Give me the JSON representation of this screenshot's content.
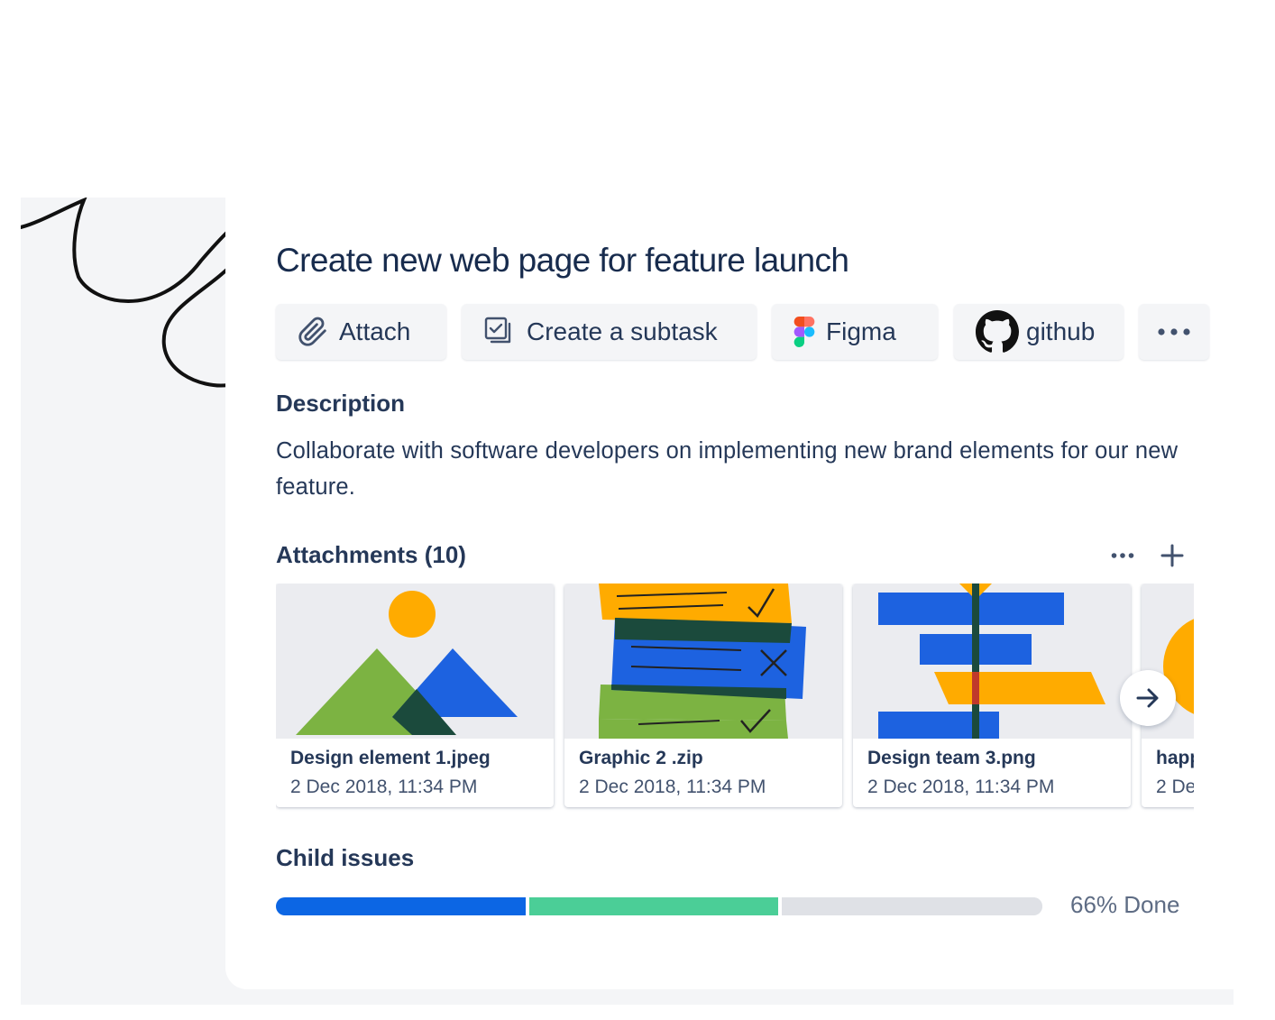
{
  "issue": {
    "title": "Create new web page for feature launch"
  },
  "toolbar": {
    "attach_label": "Attach",
    "subtask_label": "Create a subtask",
    "figma_label": "Figma",
    "github_label": "github",
    "icons": [
      "paperclip-icon",
      "subtask-icon",
      "figma-logo-icon",
      "github-logo-icon",
      "more-icon"
    ]
  },
  "description": {
    "heading": "Description",
    "text": "Collaborate with software developers on implementing new brand elements for our new feature."
  },
  "attachments": {
    "heading": "Attachments (10)",
    "items": [
      {
        "name": "Design element 1.jpeg",
        "date": "2 Dec 2018, 11:34 PM"
      },
      {
        "name": "Graphic 2 .zip",
        "date": "2 Dec 2018, 11:34 PM"
      },
      {
        "name": "Design team 3.png",
        "date": "2 Dec 2018, 11:34 PM"
      },
      {
        "name": "happ",
        "date": "2 De"
      }
    ]
  },
  "child_issues": {
    "heading": "Child issues",
    "progress_label": "66% Done",
    "segments": [
      {
        "status": "done",
        "fraction": 0.33,
        "color": "#0c66e4"
      },
      {
        "status": "in-progress",
        "fraction": 0.33,
        "color": "#4bce97"
      },
      {
        "status": "to-do",
        "fraction": 0.34,
        "color": "#dfe1e6"
      }
    ]
  },
  "colors": {
    "text_primary": "#172b4d",
    "blue": "#1d62e0",
    "green": "#7cb342",
    "yellow": "#ffab00",
    "background": "#f4f5f7"
  }
}
